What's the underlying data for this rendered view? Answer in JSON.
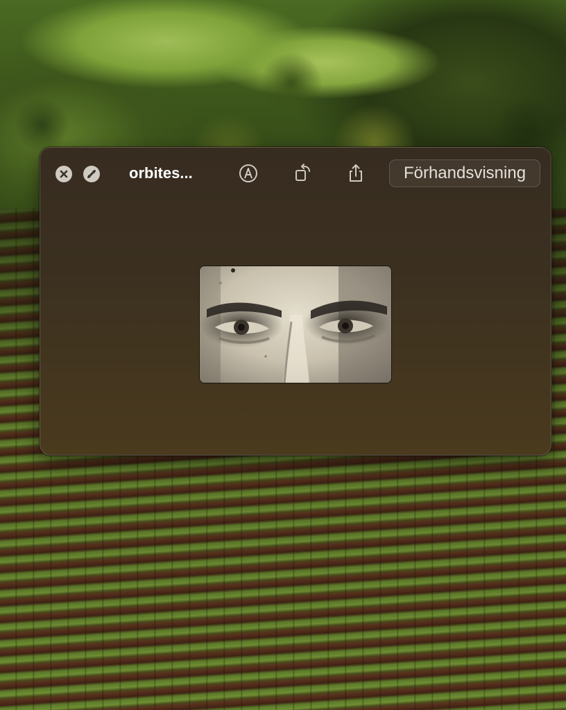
{
  "window": {
    "title": "orbites...",
    "open_with_label": "Förhandsvisning"
  },
  "toolbar_icons": {
    "close": "close-icon",
    "fullscreen": "fullscreen-icon",
    "markup": "markup-pencil-icon",
    "rotate": "rotate-icon",
    "share": "share-icon"
  },
  "preview": {
    "content": "sepia photo crop of a man's eyes"
  },
  "colors": {
    "window_bg": "#3b3020",
    "title_text": "#ffffff",
    "button_text": "#e4e0da",
    "icon": "#cfcac2"
  }
}
